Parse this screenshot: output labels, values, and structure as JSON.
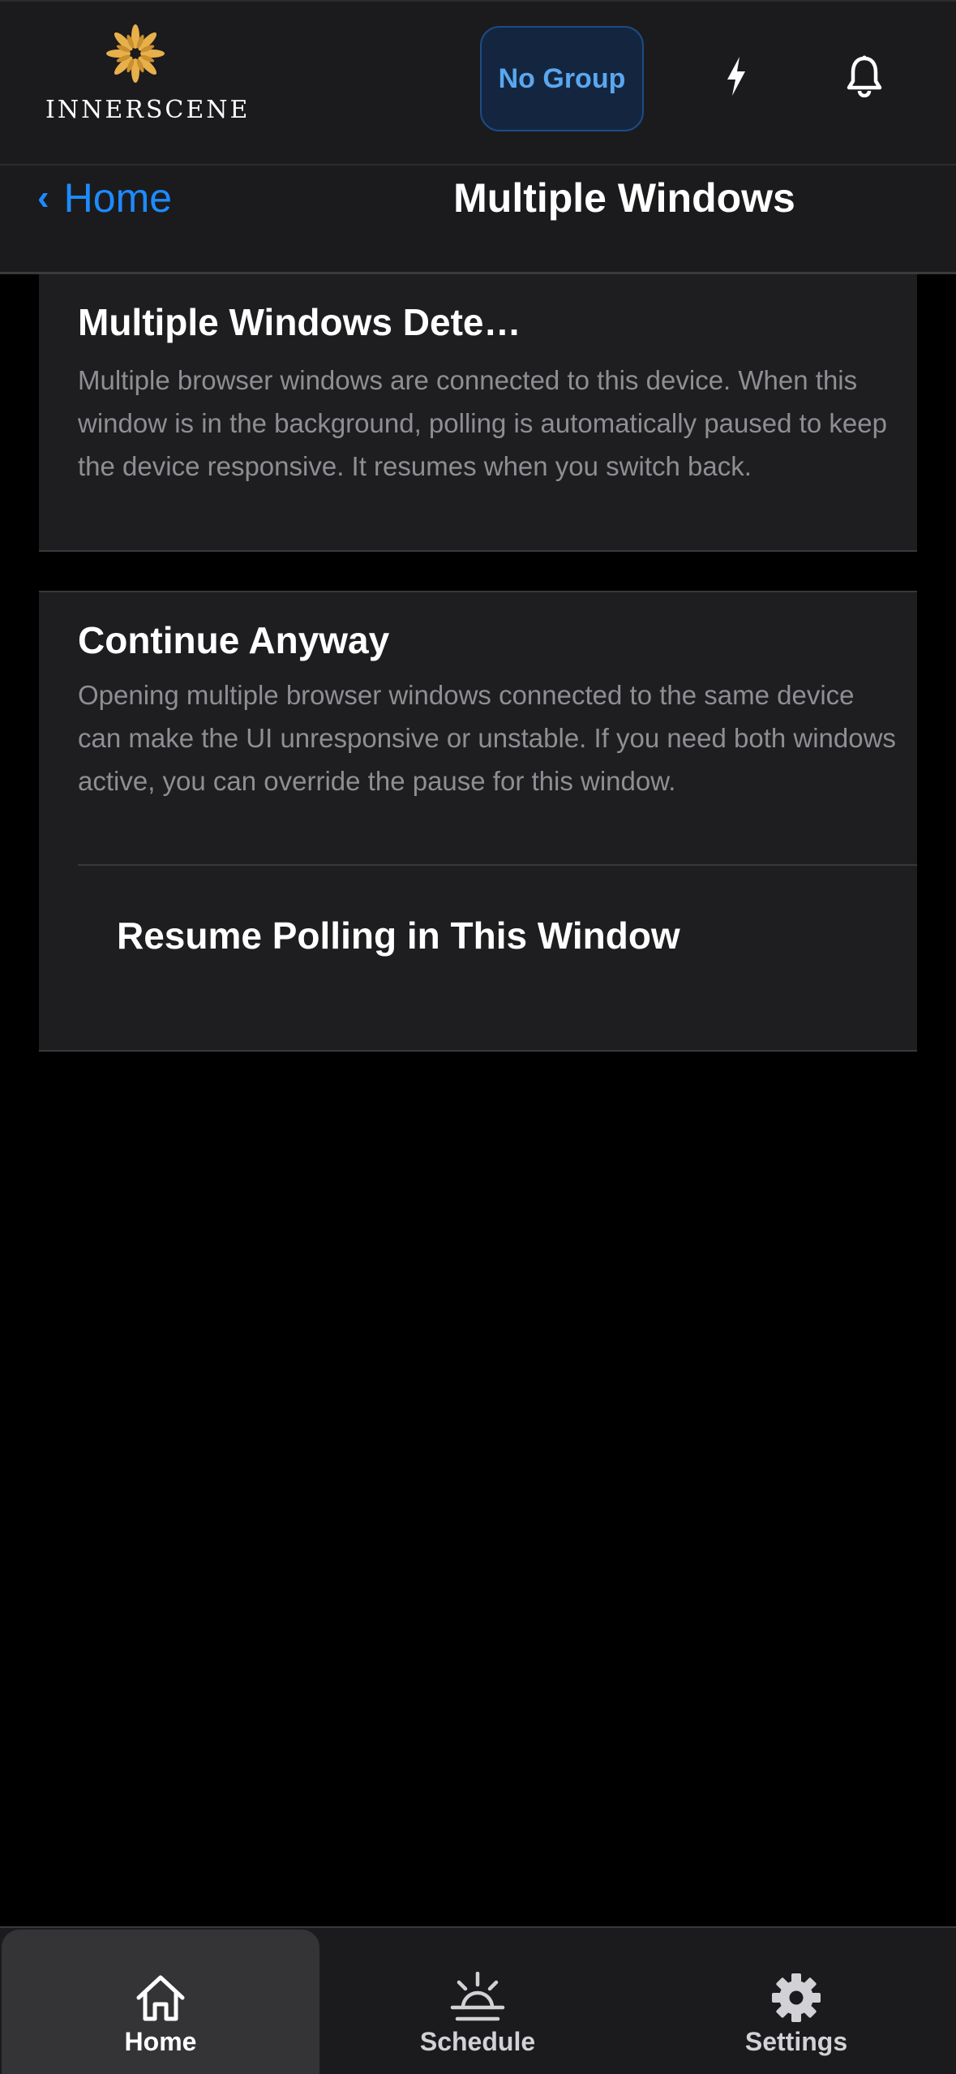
{
  "header": {
    "logo_text": "INNERSCENE",
    "group_button_label": "No Group",
    "icons": [
      "bolt-icon",
      "bell-icon"
    ],
    "brand_color": "#e8b04b",
    "accent_color": "#5aa7f0"
  },
  "nav": {
    "back_label": "Home",
    "back_chevron": "‹",
    "title": "Multiple Windows"
  },
  "cards": [
    {
      "title": "Multiple Windows Dete…",
      "description": "Multiple browser windows are connected to this device. When this window is in the background, polling is automatically paused to keep the device responsive. It resumes when you switch back."
    },
    {
      "title": "Continue Anyway",
      "description": "Opening multiple browser windows connected to the same device can make the UI unresponsive or unstable. If you need both windows active, you can override the pause for this window.",
      "action_label": "Resume Polling in This Window"
    }
  ],
  "tabbar": {
    "tabs": [
      {
        "label": "Home",
        "icon": "home-icon",
        "selected": true
      },
      {
        "label": "Schedule",
        "icon": "sunrise-icon",
        "selected": false
      },
      {
        "label": "Settings",
        "icon": "gear-icon",
        "selected": false
      }
    ]
  }
}
